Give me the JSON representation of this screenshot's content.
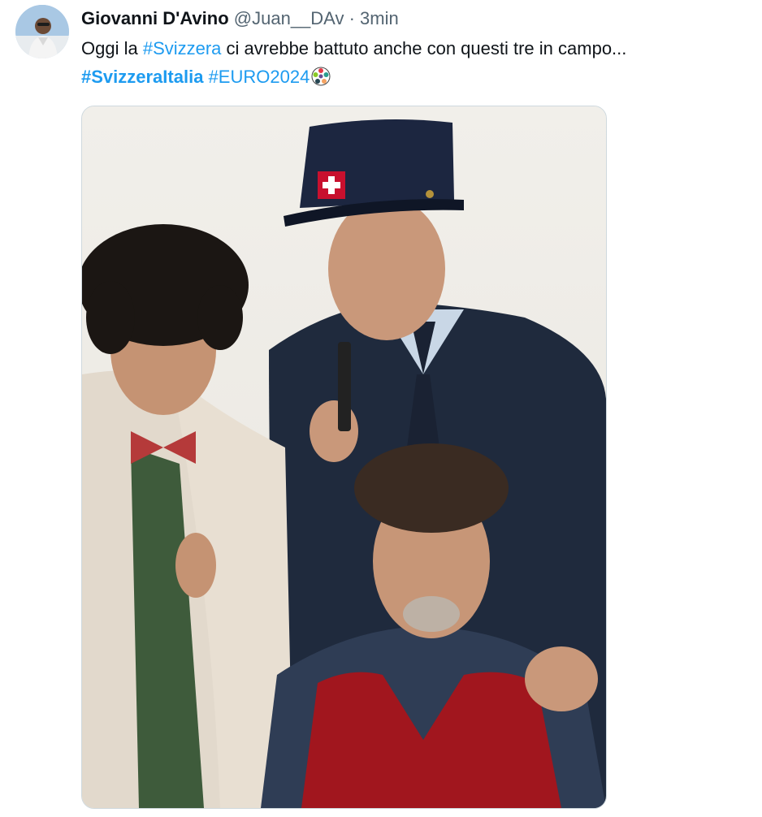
{
  "tweet": {
    "author_name": "Giovanni D'Avino",
    "handle": "@Juan__DAv",
    "separator": "·",
    "time": "3min",
    "text": {
      "part1": "Oggi la ",
      "hashtag1": "#Svizzera",
      "part2": " ci avrebbe battuto anche con questi tre in campo...",
      "hashtag2": "#SvizzeraItalia",
      "space": " ",
      "hashtag3": "#EURO2024"
    },
    "emoji_icon": "euro2024-ball-icon",
    "avatar_icon": "user-avatar",
    "media_icon": "photo-three-men-swiss-guard"
  },
  "colors": {
    "link": "#1d9bf0",
    "text": "#0f1419",
    "muted": "#536471",
    "border": "#cfd9de"
  }
}
